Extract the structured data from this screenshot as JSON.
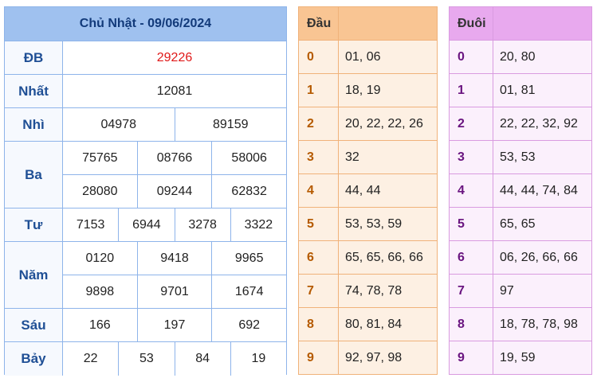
{
  "results": {
    "title": "Chủ Nhật - 09/06/2024",
    "prizes": [
      {
        "label": "ĐB",
        "rows": [
          [
            "29226"
          ]
        ],
        "special": true
      },
      {
        "label": "Nhất",
        "rows": [
          [
            "12081"
          ]
        ]
      },
      {
        "label": "Nhì",
        "rows": [
          [
            "04978",
            "89159"
          ]
        ]
      },
      {
        "label": "Ba",
        "rows": [
          [
            "75765",
            "08766",
            "58006"
          ],
          [
            "28080",
            "09244",
            "62832"
          ]
        ]
      },
      {
        "label": "Tư",
        "rows": [
          [
            "7153",
            "6944",
            "3278",
            "3322"
          ]
        ]
      },
      {
        "label": "Năm",
        "rows": [
          [
            "0120",
            "9418",
            "9965"
          ],
          [
            "9898",
            "9701",
            "1674"
          ]
        ]
      },
      {
        "label": "Sáu",
        "rows": [
          [
            "166",
            "197",
            "692"
          ]
        ]
      },
      {
        "label": "Bảy",
        "rows": [
          [
            "22",
            "53",
            "84",
            "19"
          ]
        ]
      }
    ]
  },
  "dau": {
    "header": "Đầu",
    "rows": [
      {
        "digit": "0",
        "values": "01, 06"
      },
      {
        "digit": "1",
        "values": "18, 19"
      },
      {
        "digit": "2",
        "values": "20, 22, 22, 26"
      },
      {
        "digit": "3",
        "values": "32"
      },
      {
        "digit": "4",
        "values": "44, 44"
      },
      {
        "digit": "5",
        "values": "53, 53, 59"
      },
      {
        "digit": "6",
        "values": "65, 65, 66, 66"
      },
      {
        "digit": "7",
        "values": "74, 78, 78"
      },
      {
        "digit": "8",
        "values": "80, 81, 84"
      },
      {
        "digit": "9",
        "values": "92, 97, 98"
      }
    ]
  },
  "duoi": {
    "header": "Đuôi",
    "rows": [
      {
        "digit": "0",
        "values": "20, 80"
      },
      {
        "digit": "1",
        "values": "01, 81"
      },
      {
        "digit": "2",
        "values": "22, 22, 32, 92"
      },
      {
        "digit": "3",
        "values": "53, 53"
      },
      {
        "digit": "4",
        "values": "44, 44, 74, 84"
      },
      {
        "digit": "5",
        "values": "65, 65"
      },
      {
        "digit": "6",
        "values": "06, 26, 66, 66"
      },
      {
        "digit": "7",
        "values": "97"
      },
      {
        "digit": "8",
        "values": "18, 78, 78, 98"
      },
      {
        "digit": "9",
        "values": "19, 59"
      }
    ]
  },
  "colors": {
    "special_number": "#e01818",
    "results_accent": "#9fc1ef",
    "dau_accent": "#f9c593",
    "duoi_accent": "#e8a9ee"
  }
}
